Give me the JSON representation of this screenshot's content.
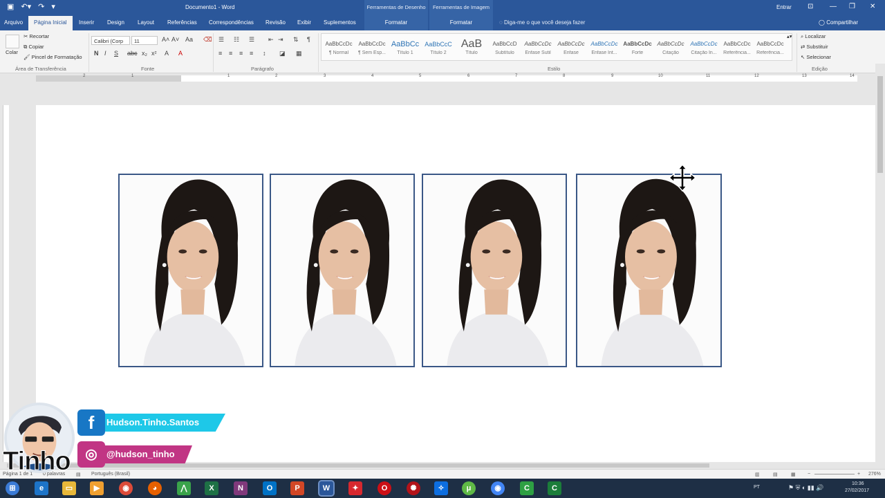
{
  "titlebar": {
    "doc_title": "Documento1  -  Word",
    "ctx_drawing": "Ferramentas de Desenho",
    "ctx_image": "Ferramentas de Imagem",
    "signin": "Entrar"
  },
  "tabs": {
    "arquivo": "Arquivo",
    "inicio": "Página Inicial",
    "inserir": "Inserir",
    "design": "Design",
    "layout": "Layout",
    "referencias": "Referências",
    "correspondencias": "Correspondências",
    "revisao": "Revisão",
    "exibir": "Exibir",
    "suplementos": "Suplementos",
    "formatar1": "Formatar",
    "formatar2": "Formatar",
    "tellme": "Diga-me o que você deseja fazer",
    "share": "Compartilhar"
  },
  "ribbon": {
    "clipboard": {
      "paste": "Colar",
      "cut": "Recortar",
      "copy": "Copiar",
      "painter": "Pincel de Formatação",
      "label": "Área de Transferência"
    },
    "font": {
      "family": "Calibri (Corp",
      "size": "11",
      "label": "Fonte"
    },
    "paragraph": {
      "label": "Parágrafo"
    },
    "styles": {
      "label": "Estilo",
      "items": [
        {
          "sample": "AaBbCcDc",
          "name": "¶ Normal"
        },
        {
          "sample": "AaBbCcDc",
          "name": "¶ Sem Esp..."
        },
        {
          "sample": "AaBbCc",
          "name": "Título 1"
        },
        {
          "sample": "AaBbCcC",
          "name": "Título 2"
        },
        {
          "sample": "AaB",
          "name": "Título"
        },
        {
          "sample": "AaBbCcD",
          "name": "Subtítulo"
        },
        {
          "sample": "AaBbCcDc",
          "name": "Ênfase Sutil"
        },
        {
          "sample": "AaBbCcDc",
          "name": "Ênfase"
        },
        {
          "sample": "AaBbCcDc",
          "name": "Ênfase Int..."
        },
        {
          "sample": "AaBbCcDc",
          "name": "Forte"
        },
        {
          "sample": "AaBbCcDc",
          "name": "Citação"
        },
        {
          "sample": "AaBbCcDc",
          "name": "Citação In..."
        },
        {
          "sample": "AaBbCcDc",
          "name": "Referência..."
        },
        {
          "sample": "AaBbCcDc",
          "name": "Referência..."
        }
      ]
    },
    "editing": {
      "find": "Localizar",
      "replace": "Substituir",
      "select": "Selecionar",
      "label": "Edição"
    }
  },
  "ruler": {
    "numbers": [
      "2",
      "1",
      "1",
      "2",
      "3",
      "4",
      "5",
      "6",
      "7",
      "8",
      "9",
      "10",
      "11",
      "12",
      "13",
      "14"
    ]
  },
  "statusbar": {
    "page": "Página 1 de 1",
    "words": "0 palavras",
    "language": "Português (Brasil)",
    "zoom": "276%"
  },
  "taskbar": {
    "lang": "PT",
    "time": "10:36",
    "date": "27/02/2017"
  },
  "overlay": {
    "brand": "Tinho",
    "facebook": "Hudson.Tinho.Santos",
    "instagram": "@hudson_tinho"
  },
  "colors": {
    "word_blue": "#2b579a",
    "facebook": "#1877c5",
    "instagram": "#c13584",
    "cyan": "#1ec8e8",
    "photo_border": "#3a5786"
  },
  "photos": {
    "count": 4
  }
}
